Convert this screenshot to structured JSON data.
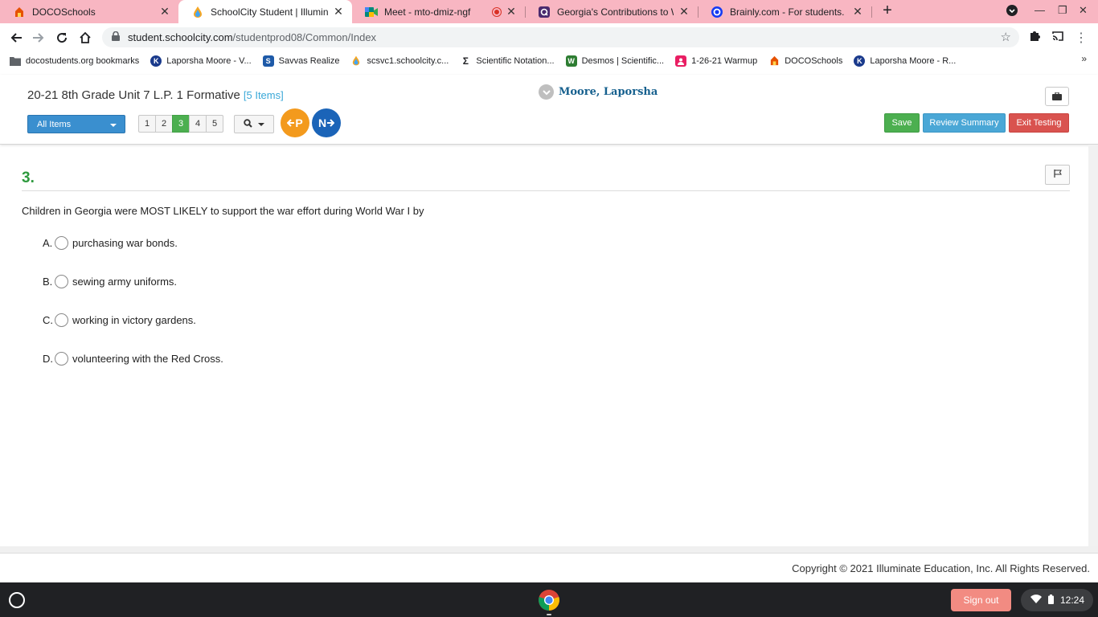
{
  "browser": {
    "tabs": [
      {
        "title": "DOCOSchools",
        "favicon": "docoschools-icon"
      },
      {
        "title": "SchoolCity Student | Illuminate E",
        "favicon": "schoolcity-icon"
      },
      {
        "title": "Meet - mto-dmiz-ngf",
        "favicon": "meet-icon"
      },
      {
        "title": "Georgia's Contributions to WWI",
        "favicon": "quizlet-icon"
      },
      {
        "title": "Brainly.com - For students. By st",
        "favicon": "brainly-icon"
      }
    ],
    "url_host": "student.schoolcity.com",
    "url_path": "/studentprod08/Common/Index",
    "bookmarks": [
      {
        "label": "docostudents.org bookmarks",
        "color": "#5f6368",
        "glyph": ""
      },
      {
        "label": "Laporsha Moore - V...",
        "color": "#1a3a8c",
        "glyph": "K"
      },
      {
        "label": "Savvas Realize",
        "color": "#1e5aa8",
        "glyph": "S"
      },
      {
        "label": "scsvc1.schoolcity.c...",
        "color": "#f5a623",
        "glyph": ""
      },
      {
        "label": "Scientific Notation...",
        "color": "#202124",
        "glyph": "Σ"
      },
      {
        "label": "Desmos | Scientific...",
        "color": "#2e7d32",
        "glyph": "W"
      },
      {
        "label": "1-26-21 Warmup",
        "color": "#e91e63",
        "glyph": ""
      },
      {
        "label": "DOCOSchools",
        "color": "#e65100",
        "glyph": ""
      },
      {
        "label": "Laporsha Moore - R...",
        "color": "#1a3a8c",
        "glyph": "K"
      }
    ]
  },
  "app": {
    "test_title": "20-21 8th Grade Unit 7 L.P. 1 Formative",
    "item_count": "[5 Items]",
    "student_name": "Moore, Laporsha",
    "all_items_label": "All Items",
    "pages": [
      "1",
      "2",
      "3",
      "4",
      "5"
    ],
    "current_page": "3",
    "prev_label": "P",
    "next_label": "N",
    "save_label": "Save",
    "review_label": "Review Summary",
    "exit_label": "Exit Testing"
  },
  "question": {
    "number": "3.",
    "text": "Children in Georgia were MOST LIKELY to support the war effort during World War I by",
    "choices": [
      {
        "letter": "A.",
        "text": "purchasing war bonds."
      },
      {
        "letter": "B.",
        "text": "sewing army uniforms."
      },
      {
        "letter": "C.",
        "text": "working in victory gardens."
      },
      {
        "letter": "D.",
        "text": "volunteering with the Red Cross."
      }
    ]
  },
  "footer": {
    "copyright": "Copyright © 2021 Illuminate Education, Inc. All Rights Reserved."
  },
  "shelf": {
    "signout_label": "Sign out",
    "clock": "12:24"
  },
  "colors": {
    "tab_strip": "#f8b6c2",
    "accent_green": "#4caf50",
    "accent_blue": "#4aa7d6",
    "exit_red": "#d9534f",
    "question_green": "#2e9a3e"
  }
}
